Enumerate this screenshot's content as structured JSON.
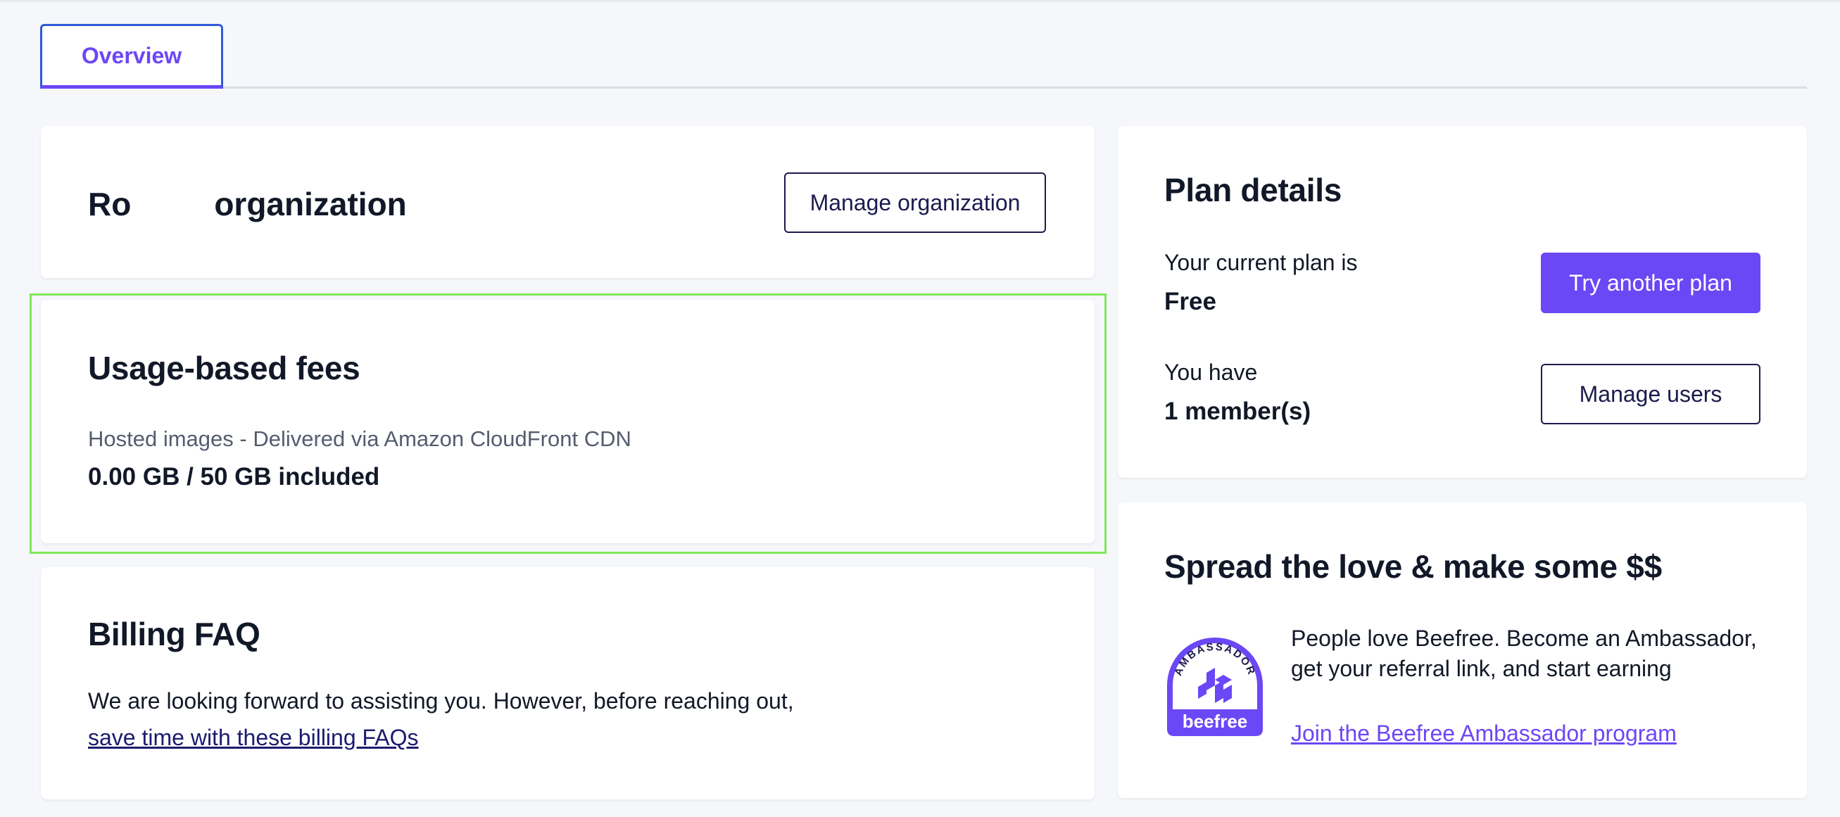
{
  "tabs": {
    "overview": "Overview"
  },
  "org": {
    "name_start": "Ro",
    "name_end": "organization",
    "manage_button": "Manage organization"
  },
  "usage": {
    "title": "Usage-based fees",
    "description": "Hosted images - Delivered via Amazon CloudFront CDN",
    "value": "0.00 GB / 50 GB included"
  },
  "faq": {
    "title": "Billing FAQ",
    "text": "We are looking forward to assisting you. However, before reaching out,",
    "link": "save time with these billing FAQs"
  },
  "plan": {
    "title": "Plan details",
    "current_label": "Your current plan is",
    "current_value": "Free",
    "try_button": "Try another plan",
    "members_label": "You have",
    "members_value": "1 member(s)",
    "manage_users_button": "Manage users"
  },
  "ambassador": {
    "title": "Spread the love & make some $$",
    "badge_arc_text": "AMBASSADOR",
    "badge_brand": "beefree",
    "text": "People love Beefree. Become an Ambassador, get your referral link, and start earning",
    "link": "Join the Beefree Ambassador program"
  },
  "colors": {
    "accent": "#6b47f5",
    "navy": "#1c1b4d",
    "highlight": "#7ee85a",
    "background": "#f6f7fa"
  }
}
